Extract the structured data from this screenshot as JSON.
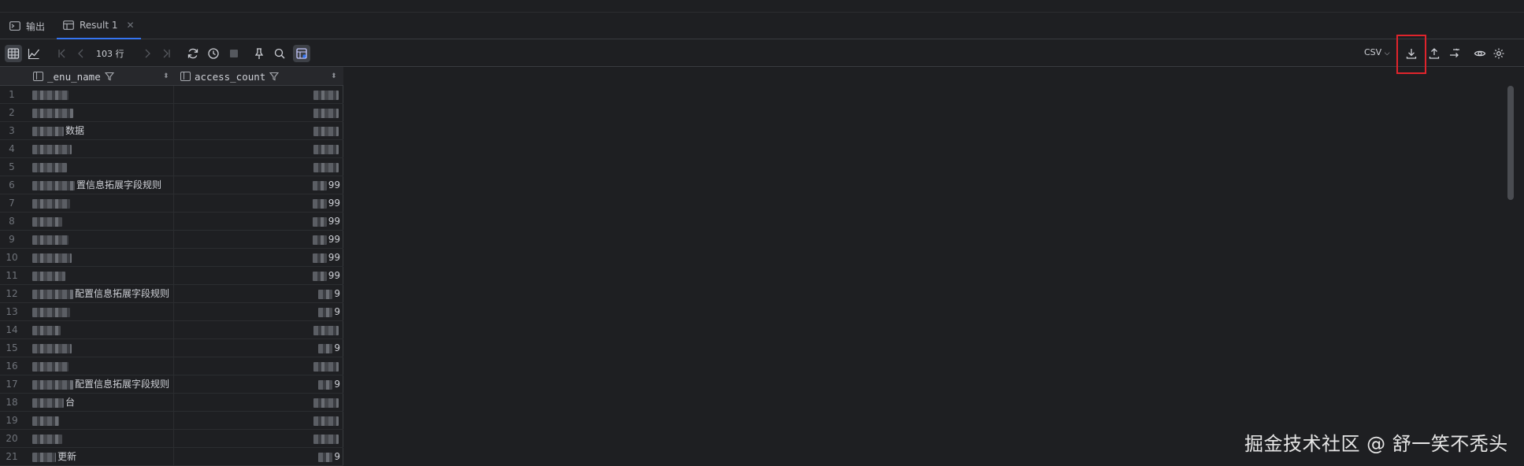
{
  "tabs": [
    {
      "label": "输出",
      "icon": "console-icon"
    },
    {
      "label": "Result 1",
      "icon": "table-icon"
    }
  ],
  "toolbar": {
    "row_count": "103 行",
    "export_format": "CSV"
  },
  "columns": [
    {
      "name": "_enu_name"
    },
    {
      "name": "access_count"
    }
  ],
  "rows": [
    {
      "n": "1",
      "menu_name": "",
      "access_count": ""
    },
    {
      "n": "2",
      "menu_name": "",
      "access_count": ""
    },
    {
      "n": "3",
      "menu_name": "数据",
      "access_count": ""
    },
    {
      "n": "4",
      "menu_name": "",
      "access_count": ""
    },
    {
      "n": "5",
      "menu_name": "",
      "access_count": ""
    },
    {
      "n": "6",
      "menu_name": "置信息拓展字段规则",
      "access_count": "99"
    },
    {
      "n": "7",
      "menu_name": "",
      "access_count": "99"
    },
    {
      "n": "8",
      "menu_name": "",
      "access_count": "99"
    },
    {
      "n": "9",
      "menu_name": "",
      "access_count": "99"
    },
    {
      "n": "10",
      "menu_name": "",
      "access_count": "99"
    },
    {
      "n": "11",
      "menu_name": "",
      "access_count": "99"
    },
    {
      "n": "12",
      "menu_name": "配置信息拓展字段规则",
      "access_count": "9"
    },
    {
      "n": "13",
      "menu_name": "",
      "access_count": "9"
    },
    {
      "n": "14",
      "menu_name": "",
      "access_count": ""
    },
    {
      "n": "15",
      "menu_name": "",
      "access_count": "9"
    },
    {
      "n": "16",
      "menu_name": "",
      "access_count": ""
    },
    {
      "n": "17",
      "menu_name": "配置信息拓展字段规则",
      "access_count": "9"
    },
    {
      "n": "18",
      "menu_name": "台",
      "access_count": ""
    },
    {
      "n": "19",
      "menu_name": "",
      "access_count": ""
    },
    {
      "n": "20",
      "menu_name": "",
      "access_count": ""
    },
    {
      "n": "21",
      "menu_name": "更新",
      "access_count": "9"
    }
  ],
  "watermark": "掘金技术社区 @ 舒一笑不秃头"
}
